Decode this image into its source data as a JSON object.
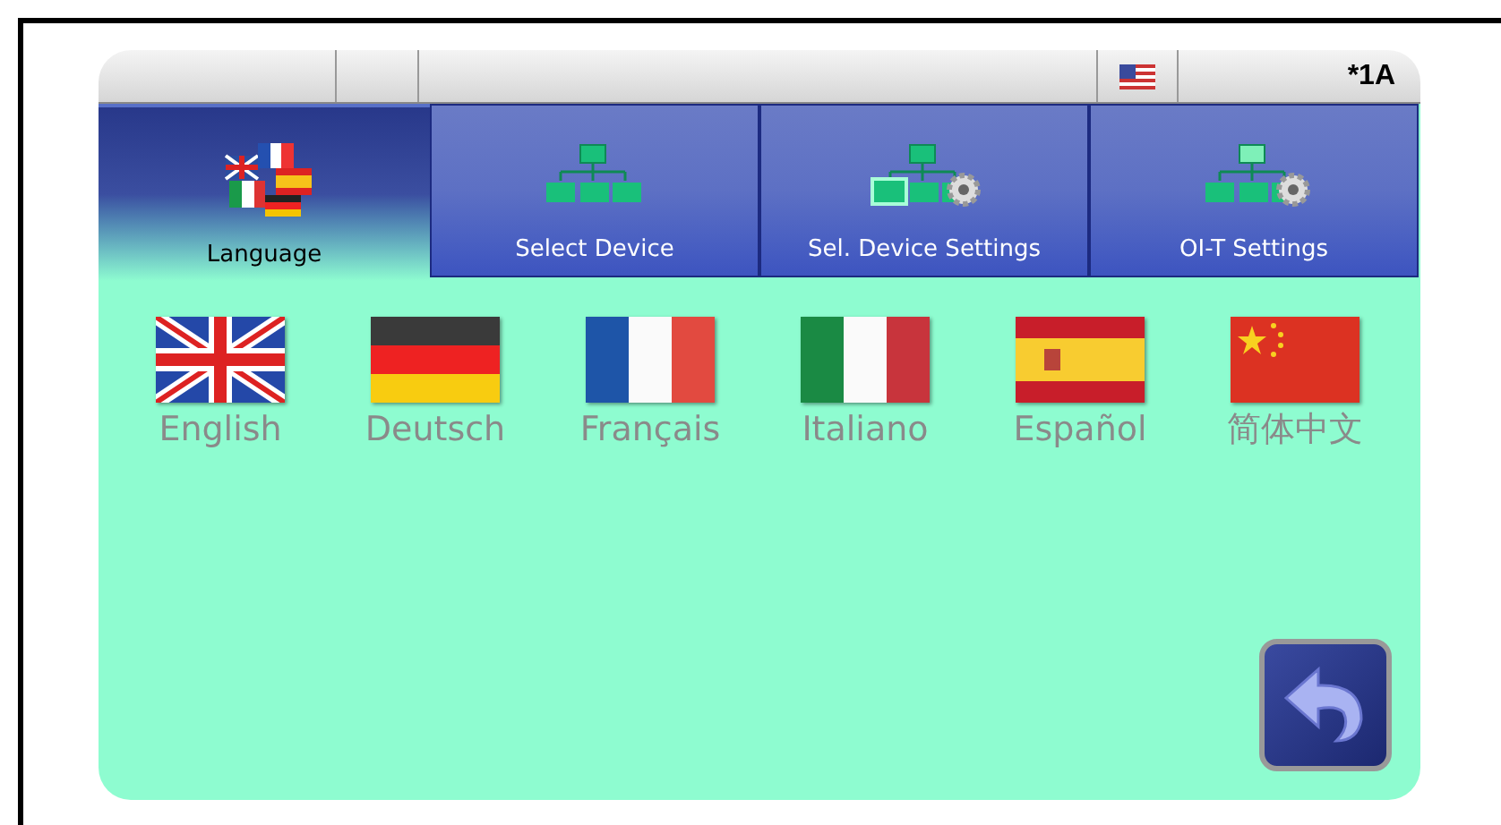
{
  "status_bar": {
    "indicator": "*1A"
  },
  "tabs": [
    {
      "label": "Language",
      "selected": true,
      "kind": "flags"
    },
    {
      "label": "Select Device",
      "selected": false,
      "kind": "network"
    },
    {
      "label": "Sel. Device Settings",
      "selected": false,
      "kind": "network-gear-outlined"
    },
    {
      "label": "OI-T Settings",
      "selected": false,
      "kind": "network-gear"
    }
  ],
  "languages": [
    {
      "label": "English",
      "kind": "gb"
    },
    {
      "label": "Deutsch",
      "kind": "de"
    },
    {
      "label": "Français",
      "kind": "fr"
    },
    {
      "label": "Italiano",
      "kind": "it"
    },
    {
      "label": "Español",
      "kind": "es"
    },
    {
      "label": "简体中文",
      "kind": "cn"
    }
  ]
}
